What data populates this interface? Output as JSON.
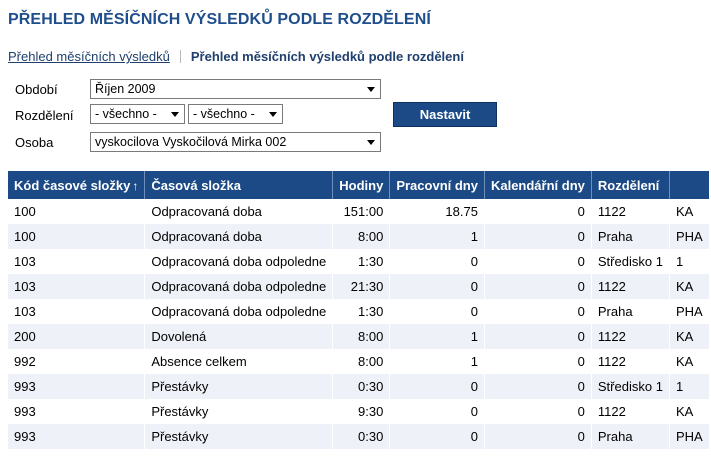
{
  "title": "PŘEHLED MĚSÍČNÍCH VÝSLEDKŮ PODLE ROZDĚLENÍ",
  "breadcrumb": {
    "link": "Přehled měsíčních výsledků",
    "current": "Přehled měsíčních výsledků podle rozdělení"
  },
  "form": {
    "obdobi_label": "Období",
    "obdobi_value": "Říjen 2009",
    "rozdeleni_label": "Rozdělení",
    "rozdeleni_value_1": "- všechno -",
    "rozdeleni_value_2": "- všechno -",
    "osoba_label": "Osoba",
    "osoba_value": "vyskocilova Vyskočilová Mirka 002",
    "submit_label": "Nastavit"
  },
  "table": {
    "headers": {
      "kod": "Kód časové složky",
      "slozka": "Časová složka",
      "hodiny": "Hodiny",
      "pracovni": "Pracovní dny",
      "kalendarni": "Kalendářní dny",
      "rozdeleni": "Rozdělení",
      "extra": ""
    },
    "sort_indicator": "↑",
    "rows": [
      {
        "kod": "100",
        "slozka": "Odpracovaná doba",
        "hodiny": "151:00",
        "pracovni": "18.75",
        "kalendarni": "0",
        "rozdeleni": "1122",
        "extra": "KA"
      },
      {
        "kod": "100",
        "slozka": "Odpracovaná doba",
        "hodiny": "8:00",
        "pracovni": "1",
        "kalendarni": "0",
        "rozdeleni": "Praha",
        "extra": "PHA"
      },
      {
        "kod": "103",
        "slozka": "Odpracovaná doba odpoledne",
        "hodiny": "1:30",
        "pracovni": "0",
        "kalendarni": "0",
        "rozdeleni": "Středisko 1",
        "extra": "1"
      },
      {
        "kod": "103",
        "slozka": "Odpracovaná doba odpoledne",
        "hodiny": "21:30",
        "pracovni": "0",
        "kalendarni": "0",
        "rozdeleni": "1122",
        "extra": "KA"
      },
      {
        "kod": "103",
        "slozka": "Odpracovaná doba odpoledne",
        "hodiny": "1:30",
        "pracovni": "0",
        "kalendarni": "0",
        "rozdeleni": "Praha",
        "extra": "PHA"
      },
      {
        "kod": "200",
        "slozka": "Dovolená",
        "hodiny": "8:00",
        "pracovni": "1",
        "kalendarni": "0",
        "rozdeleni": "1122",
        "extra": "KA"
      },
      {
        "kod": "992",
        "slozka": "Absence celkem",
        "hodiny": "8:00",
        "pracovni": "1",
        "kalendarni": "0",
        "rozdeleni": "1122",
        "extra": "KA"
      },
      {
        "kod": "993",
        "slozka": "Přestávky",
        "hodiny": "0:30",
        "pracovni": "0",
        "kalendarni": "0",
        "rozdeleni": "Středisko 1",
        "extra": "1"
      },
      {
        "kod": "993",
        "slozka": "Přestávky",
        "hodiny": "9:30",
        "pracovni": "0",
        "kalendarni": "0",
        "rozdeleni": "1122",
        "extra": "KA"
      },
      {
        "kod": "993",
        "slozka": "Přestávky",
        "hodiny": "0:30",
        "pracovni": "0",
        "kalendarni": "0",
        "rozdeleni": "Praha",
        "extra": "PHA"
      }
    ]
  }
}
